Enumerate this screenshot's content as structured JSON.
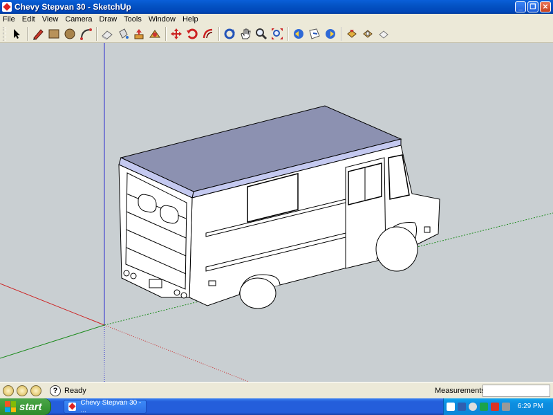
{
  "window": {
    "title": "Chevy Stepvan 30 - SketchUp"
  },
  "menu": [
    "File",
    "Edit",
    "View",
    "Camera",
    "Draw",
    "Tools",
    "Window",
    "Help"
  ],
  "toolbar": {
    "tools": [
      "select-icon",
      "pencil-icon",
      "rectangle-icon",
      "circle-icon",
      "arc-icon",
      "eraser-icon",
      "paint-bucket-icon",
      "push-pull-icon",
      "follow-me-icon",
      "move-icon",
      "rotate-icon",
      "offset-icon",
      "scale-icon",
      "orbit-icon",
      "pan-icon",
      "zoom-icon",
      "zoom-extents-icon",
      "previous-view-icon",
      "next-view-icon",
      "position-camera-icon",
      "walk-icon",
      "look-around-icon",
      "section-plane-icon"
    ]
  },
  "status": {
    "text": "Ready",
    "measurements_label": "Measurements",
    "measurements_value": ""
  },
  "taskbar": {
    "start_label": "start",
    "task_label": "Chevy Stepvan 30 - ...",
    "clock": "6:29 PM"
  },
  "colors": {
    "viewport": "#c9cfd2",
    "roof": "#8c91b1",
    "roof_edge": "#c4c9f0",
    "body": "#ffffff"
  }
}
